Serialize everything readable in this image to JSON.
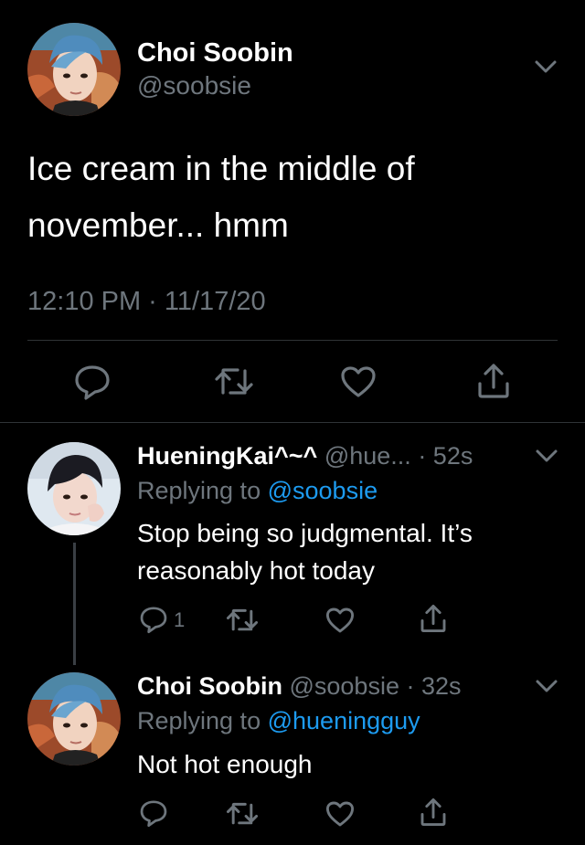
{
  "main_tweet": {
    "display_name": "Choi Soobin",
    "handle": "@soobsie",
    "text_line1": "Ice cream in the middle of",
    "text_line2": "november... hmm",
    "timestamp": "12:10 PM · 11/17/20"
  },
  "replies": [
    {
      "display_name": "HueningKai^~^",
      "handle": "@hue...",
      "time": "· 52s",
      "replying_prefix": "Replying to",
      "replying_to": "@soobsie",
      "text_line1": "Stop being so judgmental. It’s",
      "text_line2": "reasonably hot today",
      "reply_count": "1"
    },
    {
      "display_name": "Choi Soobin",
      "handle": "@soobsie",
      "time": "· 32s",
      "replying_prefix": "Replying to",
      "replying_to": "@hueningguy",
      "text_line1": "Not hot enough"
    }
  ],
  "icons": {
    "reply": "reply-icon",
    "retweet": "retweet-icon",
    "like": "heart-icon",
    "share": "share-icon",
    "more": "chevron-down-icon"
  },
  "colors": {
    "background": "#000000",
    "text": "#ffffff",
    "muted": "#6e767d",
    "link": "#1d9bf0",
    "separator": "#2f3336"
  }
}
